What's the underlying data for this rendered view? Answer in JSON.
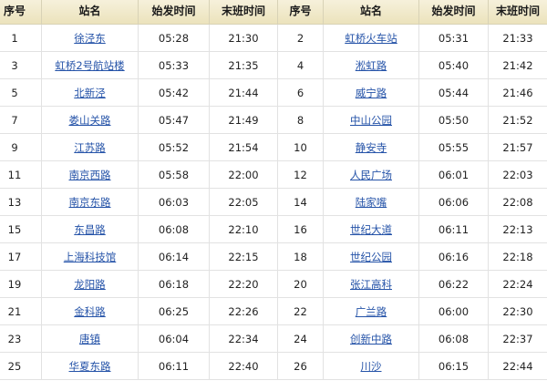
{
  "table": {
    "headers": [
      "序号",
      "站名",
      "始发时间",
      "末班时间",
      "序号",
      "站名",
      "始发时间",
      "末班时间"
    ],
    "rows": [
      [
        [
          "1",
          "徐泾东",
          "05:28",
          "21:30"
        ],
        [
          "2",
          "虹桥火车站",
          "05:31",
          "21:33"
        ]
      ],
      [
        [
          "3",
          "虹桥2号航站楼",
          "05:33",
          "21:35"
        ],
        [
          "4",
          "淞虹路",
          "05:40",
          "21:42"
        ]
      ],
      [
        [
          "5",
          "北新泾",
          "05:42",
          "21:44"
        ],
        [
          "6",
          "威宁路",
          "05:44",
          "21:46"
        ]
      ],
      [
        [
          "7",
          "娄山关路",
          "05:47",
          "21:49"
        ],
        [
          "8",
          "中山公园",
          "05:50",
          "21:52"
        ]
      ],
      [
        [
          "9",
          "江苏路",
          "05:52",
          "21:54"
        ],
        [
          "10",
          "静安寺",
          "05:55",
          "21:57"
        ]
      ],
      [
        [
          "11",
          "南京西路",
          "05:58",
          "22:00"
        ],
        [
          "12",
          "人民广场",
          "06:01",
          "22:03"
        ]
      ],
      [
        [
          "13",
          "南京东路",
          "06:03",
          "22:05"
        ],
        [
          "14",
          "陆家嘴",
          "06:06",
          "22:08"
        ]
      ],
      [
        [
          "15",
          "东昌路",
          "06:08",
          "22:10"
        ],
        [
          "16",
          "世纪大道",
          "06:11",
          "22:13"
        ]
      ],
      [
        [
          "17",
          "上海科技馆",
          "06:14",
          "22:15"
        ],
        [
          "18",
          "世纪公园",
          "06:16",
          "22:18"
        ]
      ],
      [
        [
          "19",
          "龙阳路",
          "06:18",
          "22:20"
        ],
        [
          "20",
          "张江高科",
          "06:22",
          "22:24"
        ]
      ],
      [
        [
          "21",
          "金科路",
          "06:25",
          "22:26"
        ],
        [
          "22",
          "广兰路",
          "06:00",
          "22:30"
        ]
      ],
      [
        [
          "23",
          "唐镇",
          "06:04",
          "22:34"
        ],
        [
          "24",
          "创新中路",
          "06:08",
          "22:37"
        ]
      ],
      [
        [
          "25",
          "华夏东路",
          "06:11",
          "22:40"
        ],
        [
          "26",
          "川沙",
          "06:15",
          "22:44"
        ]
      ]
    ]
  }
}
